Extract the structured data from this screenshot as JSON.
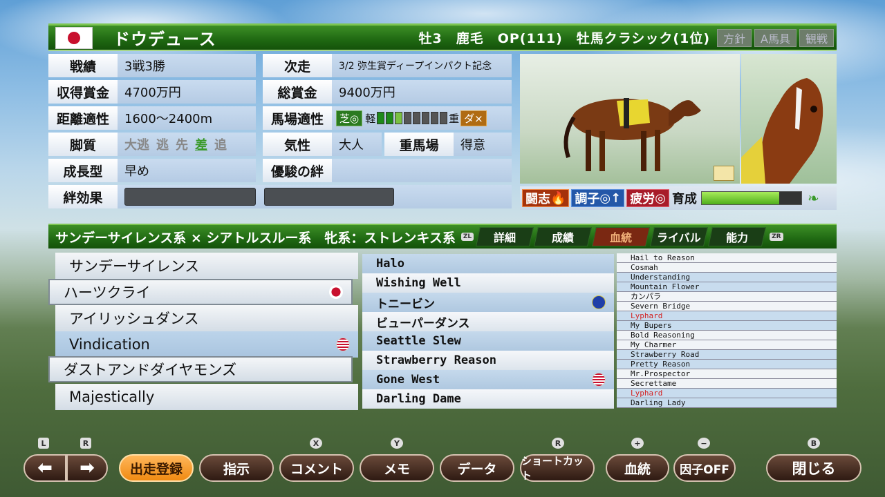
{
  "header": {
    "horse_name": "ドウデュース",
    "info": "牡3　鹿毛　OP(111)　牡馬クラシック(1位)",
    "buttons": [
      "方針",
      "A馬具",
      "観戦"
    ]
  },
  "info": {
    "record_label": "戦績",
    "record": "3戦3勝",
    "next_label": "次走",
    "next": "3/2 弥生賞ディープインパクト記念",
    "earned_label": "収得賞金",
    "earned": "4700万円",
    "total_label": "総賞金",
    "total": "9400万円",
    "distance_label": "距離適性",
    "distance": "1600～2400m",
    "track_label": "馬場適性",
    "turf": "芝◎",
    "light": "軽",
    "heavy": "重",
    "dirt": "ダ×",
    "legs_label": "脚質",
    "legs": [
      "大逃",
      "逃",
      "先",
      "差",
      "追"
    ],
    "temper_label": "気性",
    "temper": "大人",
    "heavy_track_label": "重馬場",
    "heavy_track": "得意",
    "growth_label": "成長型",
    "growth": "早め",
    "bond_label": "優駿の絆",
    "bond_effect_label": "絆効果"
  },
  "status": {
    "fight": "闘志",
    "condition": "調子",
    "fatigue": "疲労",
    "training": "育成",
    "training_level": 0.78
  },
  "lineage": {
    "text": "サンデーサイレンス系 × シアトルスルー系　牝系：ストレンキス系"
  },
  "tabs": [
    "詳細",
    "成績",
    "血統",
    "ライバル",
    "能力"
  ],
  "pedigree": {
    "g1": [
      "サンデーサイレンス",
      "ハーツクライ",
      "アイリッシュダンス",
      "Vindication",
      "ダストアンドダイヤモンズ",
      "Majestically"
    ],
    "g2": [
      "Halo",
      "Wishing Well",
      "トニービン",
      "ビューパーダンス",
      "Seattle Slew",
      "Strawberry Reason",
      "Gone West",
      "Darling Dame"
    ],
    "g3": [
      "Hail to Reason",
      "Cosmah",
      "Understanding",
      "Mountain Flower",
      "カンパラ",
      "Severn Bridge",
      "Lyphard",
      "My Bupers",
      "Bold Reasoning",
      "My Charmer",
      "Strawberry Road",
      "Pretty Reason",
      "Mr.Prospector",
      "Secrettame",
      "Lyphard",
      "Darling Lady"
    ]
  },
  "footer": {
    "buttons": [
      "出走登録",
      "指示",
      "コメント",
      "メモ",
      "データ",
      "ショートカット",
      "血統",
      "因子OFF",
      "閉じる"
    ],
    "hints": [
      "L",
      "R",
      "X",
      "Y",
      "R",
      "+",
      "−",
      "B"
    ]
  }
}
